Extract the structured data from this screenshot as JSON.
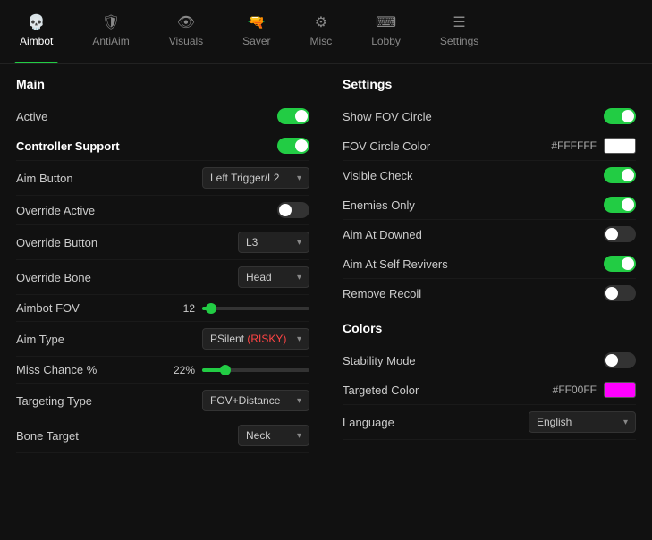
{
  "nav": {
    "items": [
      {
        "id": "aimbot",
        "label": "Aimbot",
        "icon": "💀",
        "active": true
      },
      {
        "id": "antiaim",
        "label": "AntiAim",
        "icon": "🛡",
        "active": false
      },
      {
        "id": "visuals",
        "label": "Visuals",
        "icon": "👁",
        "active": false
      },
      {
        "id": "saver",
        "label": "Saver",
        "icon": "🔫",
        "active": false
      },
      {
        "id": "misc",
        "label": "Misc",
        "icon": "⚙",
        "active": false
      },
      {
        "id": "lobby",
        "label": "Lobby",
        "icon": "🖮",
        "active": false
      },
      {
        "id": "settings",
        "label": "Settings",
        "icon": "☰",
        "active": false
      }
    ]
  },
  "left": {
    "section": "Main",
    "rows": [
      {
        "label": "Active",
        "type": "toggle",
        "state": "on",
        "bold": false
      },
      {
        "label": "Controller Support",
        "type": "toggle",
        "state": "on",
        "bold": true
      },
      {
        "label": "Aim Button",
        "type": "dropdown",
        "value": "Left Trigger/L2"
      },
      {
        "label": "Override Active",
        "type": "toggle",
        "state": "off",
        "bold": false
      },
      {
        "label": "Override Button",
        "type": "dropdown",
        "value": "L3"
      },
      {
        "label": "Override Bone",
        "type": "dropdown",
        "value": "Head"
      },
      {
        "label": "Aimbot FOV",
        "type": "slider",
        "value": 12,
        "pct": 8
      },
      {
        "label": "Aim Type",
        "type": "dropdown",
        "value": "PSilent",
        "extra": "(RISKY)"
      },
      {
        "label": "Miss Chance %",
        "type": "slider",
        "value": "22%",
        "pct": 22
      },
      {
        "label": "Targeting Type",
        "type": "dropdown",
        "value": "FOV+Distance"
      },
      {
        "label": "Bone Target",
        "type": "dropdown",
        "value": "Neck"
      }
    ]
  },
  "right": {
    "section1": "Settings",
    "rows1": [
      {
        "label": "Show FOV Circle",
        "type": "toggle",
        "state": "on"
      },
      {
        "label": "FOV Circle Color",
        "type": "color",
        "hex": "#FFFFFF",
        "color": "#ffffff"
      },
      {
        "label": "Visible Check",
        "type": "toggle",
        "state": "on"
      },
      {
        "label": "Enemies Only",
        "type": "toggle",
        "state": "on"
      },
      {
        "label": "Aim At Downed",
        "type": "toggle",
        "state": "off"
      },
      {
        "label": "Aim At Self Revivers",
        "type": "toggle",
        "state": "on"
      },
      {
        "label": "Remove Recoil",
        "type": "toggle",
        "state": "off"
      }
    ],
    "section2": "Colors",
    "rows2": [
      {
        "label": "Stability Mode",
        "type": "toggle",
        "state": "off"
      },
      {
        "label": "Targeted Color",
        "type": "color",
        "hex": "#FF00FF",
        "color": "#ff00ff"
      },
      {
        "label": "Language",
        "type": "dropdown",
        "value": "English"
      }
    ]
  }
}
